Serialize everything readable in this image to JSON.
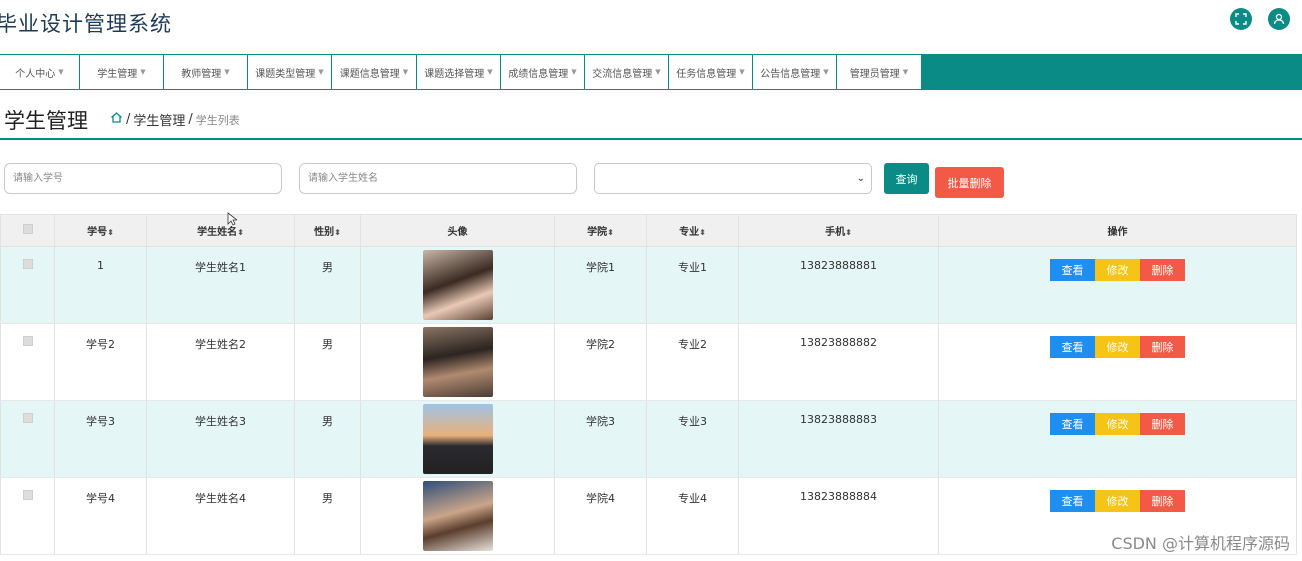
{
  "app": {
    "title": "毕业设计管理系统"
  },
  "top_icons": [
    "fullscreen-icon",
    "user-icon"
  ],
  "nav": [
    {
      "label": "个人中心"
    },
    {
      "label": "学生管理"
    },
    {
      "label": "教师管理"
    },
    {
      "label": "课题类型管理"
    },
    {
      "label": "课题信息管理"
    },
    {
      "label": "课题选择管理"
    },
    {
      "label": "成绩信息管理"
    },
    {
      "label": "交流信息管理"
    },
    {
      "label": "任务信息管理"
    },
    {
      "label": "公告信息管理"
    },
    {
      "label": "管理员管理"
    }
  ],
  "page": {
    "title": "学生管理",
    "breadcrumb": {
      "sep": "/",
      "section": "学生管理",
      "current": "学生列表"
    }
  },
  "search": {
    "id_placeholder": "请输入学号",
    "name_placeholder": "请输入学生姓名",
    "query_label": "查询",
    "batch_delete_label": "批量删除"
  },
  "table": {
    "headers": [
      "学号",
      "学生姓名",
      "性别",
      "头像",
      "学院",
      "专业",
      "手机",
      "操作"
    ],
    "sort_mark": "⬍",
    "actions": {
      "view": "查看",
      "edit": "修改",
      "delete": "删除"
    },
    "rows": [
      {
        "id": "1",
        "name": "学生姓名1",
        "gender": "男",
        "college": "学院1",
        "major": "专业1",
        "phone": "13823888881"
      },
      {
        "id": "学号2",
        "name": "学生姓名2",
        "gender": "男",
        "college": "学院2",
        "major": "专业2",
        "phone": "13823888882"
      },
      {
        "id": "学号3",
        "name": "学生姓名3",
        "gender": "男",
        "college": "学院3",
        "major": "专业3",
        "phone": "13823888883"
      },
      {
        "id": "学号4",
        "name": "学生姓名4",
        "gender": "男",
        "college": "学院4",
        "major": "专业4",
        "phone": "13823888884"
      }
    ]
  },
  "watermark": "CSDN @计算机程序源码",
  "colors": {
    "primary": "#0b8b85",
    "danger": "#f25a47",
    "info": "#1f8ef1",
    "warning": "#f6c416",
    "row_alt": "#e5f6f6"
  }
}
